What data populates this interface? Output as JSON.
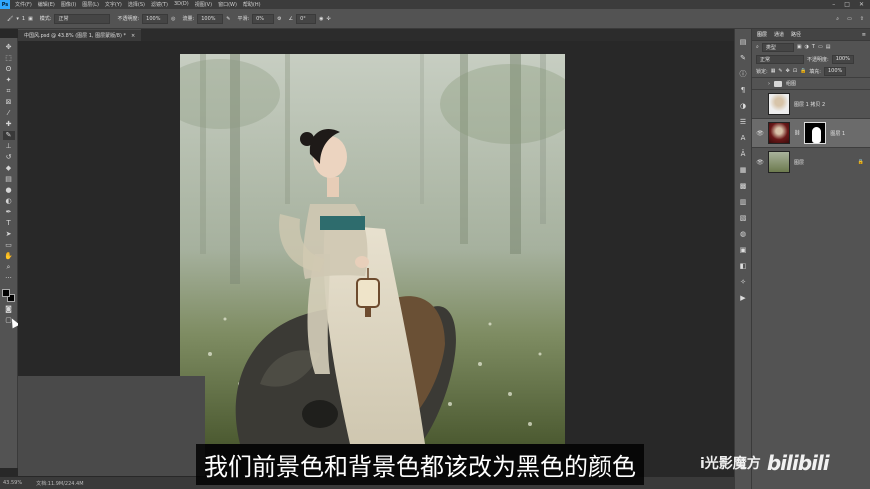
{
  "menubar": {
    "logo": "Ps",
    "items": [
      "文件(F)",
      "编辑(E)",
      "图像(I)",
      "图层(L)",
      "文字(Y)",
      "选择(S)",
      "滤镜(T)",
      "3D(D)",
      "视图(V)",
      "窗口(W)",
      "帮助(H)"
    ]
  },
  "options": {
    "mode_label": "模式:",
    "mode_value": "正常",
    "opacity_label": "不透明度:",
    "opacity_value": "100%",
    "flow_label": "流量:",
    "flow_value": "100%",
    "smooth_label": "平滑:",
    "smooth_value": "0%",
    "angle_value": "0°",
    "brush_size": "1"
  },
  "document": {
    "tab_title": "中国风.psd @ 43.8% (图层 1, 图层蒙版/8) *"
  },
  "status": {
    "zoom": "43.59%",
    "doc": "文档:11.9M/224.4M"
  },
  "layers_panel": {
    "tabs": [
      "图层",
      "通道",
      "路径"
    ],
    "kind_filter": "类型",
    "blend_mode": "正常",
    "opacity_label": "不透明度:",
    "opacity_value": "100%",
    "lock_label": "锁定:",
    "fill_label": "填充:",
    "fill_value": "100%",
    "group_name": "组图",
    "layers": [
      {
        "name": "图层 1 拷贝 2",
        "visible": false,
        "selected": false
      },
      {
        "name": "图层 1",
        "visible": true,
        "selected": true
      },
      {
        "name": "图层",
        "visible": true,
        "selected": false
      }
    ]
  },
  "subtitle": "我们前景色和背景色都该改为黑色的颜色",
  "watermark": {
    "channel": "i光影魔方",
    "site": "bilibili"
  },
  "colors": {
    "foreground": "#000000",
    "background": "#000000"
  }
}
